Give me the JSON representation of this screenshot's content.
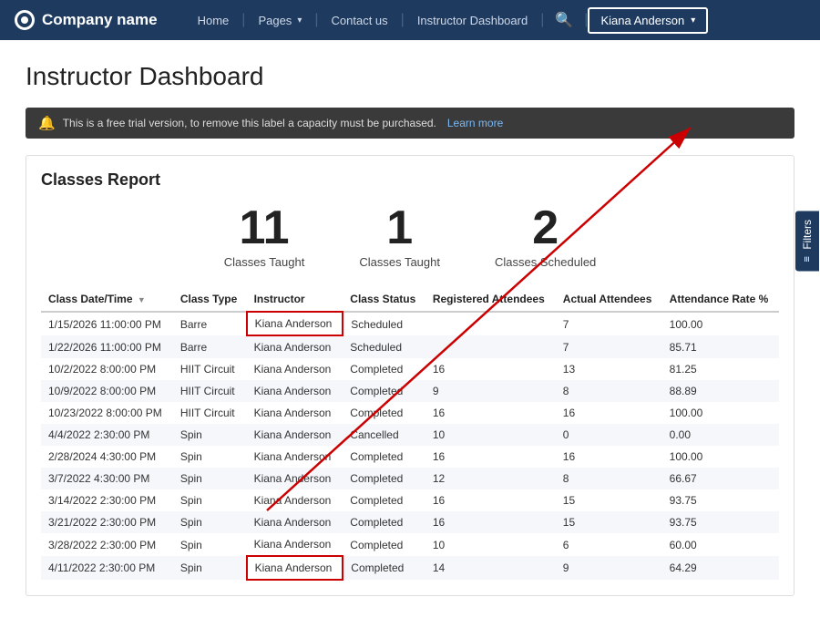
{
  "nav": {
    "logo_text": "Company name",
    "links": [
      {
        "label": "Home",
        "id": "home"
      },
      {
        "label": "Pages",
        "id": "pages",
        "dropdown": true
      },
      {
        "label": "Contact us",
        "id": "contact"
      },
      {
        "label": "Instructor Dashboard",
        "id": "instructor-dashboard"
      }
    ],
    "user_label": "Kiana Anderson"
  },
  "page": {
    "title": "Instructor Dashboard"
  },
  "banner": {
    "text": "This is a free trial version, to remove this label a capacity must be purchased.",
    "link_label": "Learn more"
  },
  "report": {
    "title": "Classes Report",
    "stats": [
      {
        "number": "11",
        "label": "Classes Taught"
      },
      {
        "number": "1",
        "label": "Classes Taught"
      },
      {
        "number": "2",
        "label": "Classes Scheduled"
      }
    ],
    "columns": [
      "Class Date/Time",
      "Class Type",
      "Instructor",
      "Class Status",
      "Registered Attendees",
      "Actual Attendees",
      "Attendance Rate %"
    ],
    "rows": [
      {
        "date": "1/15/2026 11:00:00 PM",
        "type": "Barre",
        "instructor": "Kiana Anderson",
        "status": "Scheduled",
        "registered": "",
        "actual": "7",
        "rate": "100.00",
        "highlight": true
      },
      {
        "date": "1/22/2026 11:00:00 PM",
        "type": "Barre",
        "instructor": "Kiana Anderson",
        "status": "Scheduled",
        "registered": "",
        "actual": "7",
        "rate": "85.71",
        "highlight": false
      },
      {
        "date": "10/2/2022 8:00:00 PM",
        "type": "HIIT Circuit",
        "instructor": "Kiana Anderson",
        "status": "Completed",
        "registered": "16",
        "actual": "13",
        "rate": "81.25",
        "highlight": false
      },
      {
        "date": "10/9/2022 8:00:00 PM",
        "type": "HIIT Circuit",
        "instructor": "Kiana Anderson",
        "status": "Completed",
        "registered": "9",
        "actual": "8",
        "rate": "88.89",
        "highlight": false
      },
      {
        "date": "10/23/2022 8:00:00 PM",
        "type": "HIIT Circuit",
        "instructor": "Kiana Anderson",
        "status": "Completed",
        "registered": "16",
        "actual": "16",
        "rate": "100.00",
        "highlight": false
      },
      {
        "date": "4/4/2022 2:30:00 PM",
        "type": "Spin",
        "instructor": "Kiana Anderson",
        "status": "Cancelled",
        "registered": "10",
        "actual": "0",
        "rate": "0.00",
        "highlight": false
      },
      {
        "date": "2/28/2024 4:30:00 PM",
        "type": "Spin",
        "instructor": "Kiana Anderson",
        "status": "Completed",
        "registered": "16",
        "actual": "16",
        "rate": "100.00",
        "highlight": false
      },
      {
        "date": "3/7/2022 4:30:00 PM",
        "type": "Spin",
        "instructor": "Kiana Anderson",
        "status": "Completed",
        "registered": "12",
        "actual": "8",
        "rate": "66.67",
        "highlight": false
      },
      {
        "date": "3/14/2022 2:30:00 PM",
        "type": "Spin",
        "instructor": "Kiana Anderson",
        "status": "Completed",
        "registered": "16",
        "actual": "15",
        "rate": "93.75",
        "highlight": false
      },
      {
        "date": "3/21/2022 2:30:00 PM",
        "type": "Spin",
        "instructor": "Kiana Anderson",
        "status": "Completed",
        "registered": "16",
        "actual": "15",
        "rate": "93.75",
        "highlight": false
      },
      {
        "date": "3/28/2022 2:30:00 PM",
        "type": "Spin",
        "instructor": "Kiana Anderson",
        "status": "Completed",
        "registered": "10",
        "actual": "6",
        "rate": "60.00",
        "highlight": false
      },
      {
        "date": "4/11/2022 2:30:00 PM",
        "type": "Spin",
        "instructor": "Kiana Anderson",
        "status": "Completed",
        "registered": "14",
        "actual": "9",
        "rate": "64.29",
        "highlight": true
      }
    ],
    "filters_label": "Filters"
  }
}
